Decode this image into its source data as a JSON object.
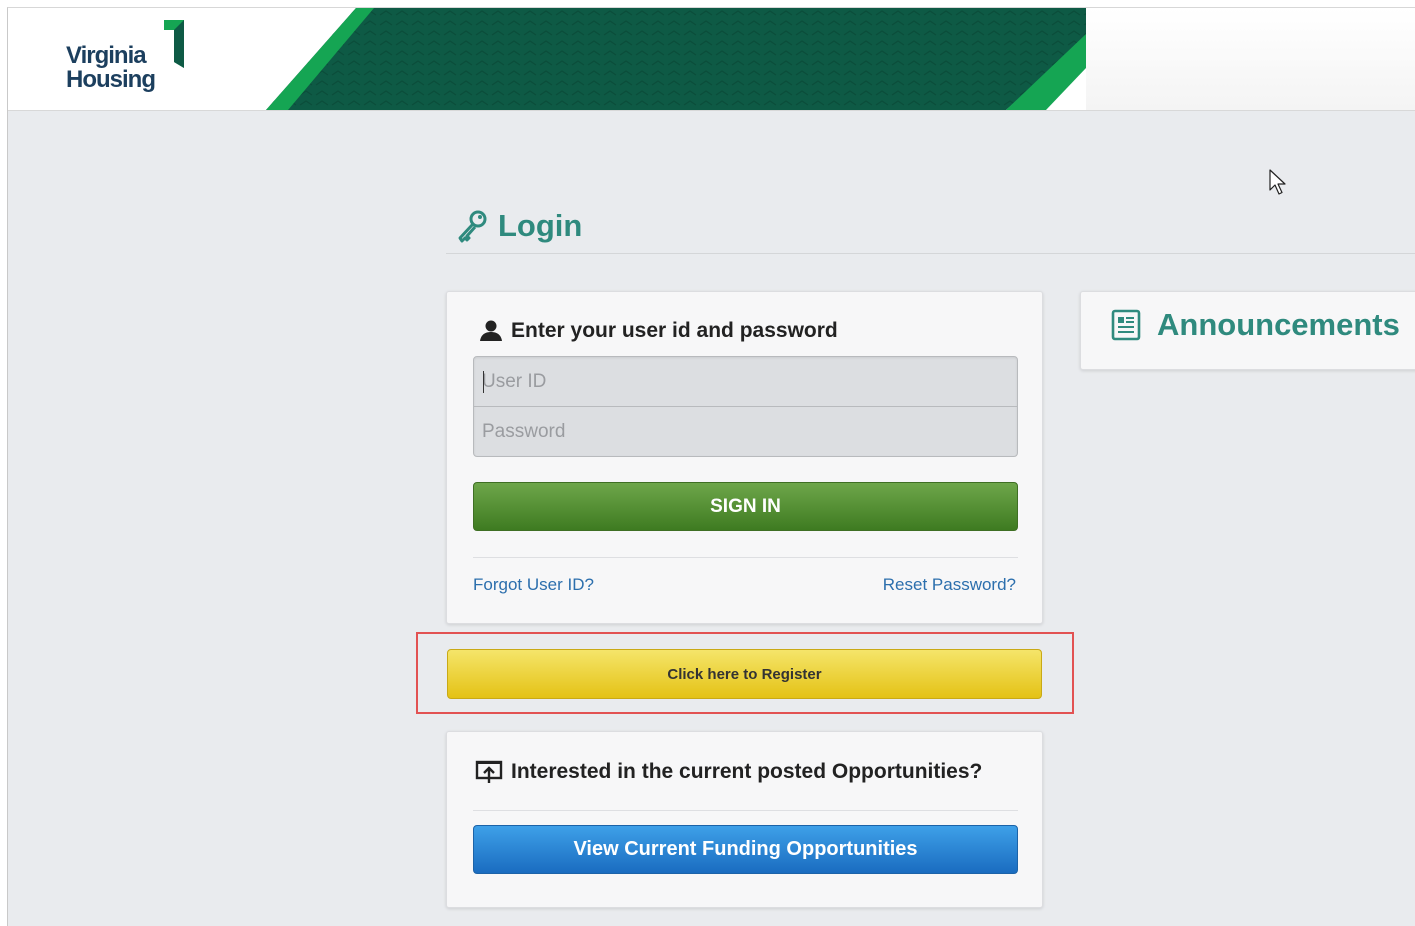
{
  "header": {
    "logo": {
      "line1": "Virginia",
      "line2": "Housing"
    },
    "colors": {
      "banner_dark": "#0e5a45",
      "banner_light": "#15a553",
      "logo_text": "#1c3f5e"
    }
  },
  "login": {
    "title": "Login",
    "title_icon": "key-icon",
    "heading": "Enter your user id and password",
    "heading_icon": "user-icon",
    "user_id_placeholder": "User ID",
    "user_id_value": "",
    "password_placeholder": "Password",
    "password_value": "",
    "sign_in_label": "SIGN IN",
    "forgot_label": "Forgot User ID?",
    "reset_label": "Reset Password?"
  },
  "register": {
    "label": "Click here to Register"
  },
  "opportunities": {
    "heading": "Interested in the current posted Opportunities?",
    "heading_icon": "presentation-icon",
    "button_label": "View Current Funding Opportunities"
  },
  "announcements": {
    "title": "Announcements",
    "icon": "document-icon"
  },
  "colors": {
    "accent_teal": "#2f8a7e",
    "sign_in_green": "#4e8c31",
    "register_yellow": "#ecd12d",
    "funding_blue": "#2784d6",
    "link_blue": "#2c6fad",
    "highlight_red": "#e25252"
  }
}
